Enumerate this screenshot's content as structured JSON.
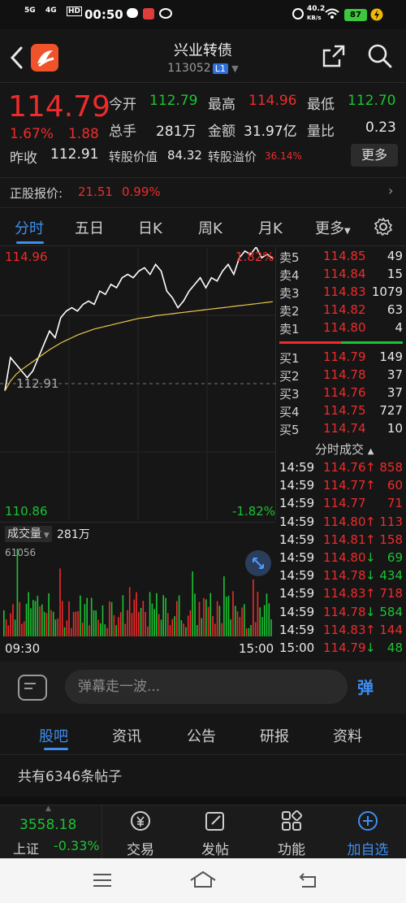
{
  "status_bar": {
    "time": "00:50",
    "signal1": "5G",
    "signal2": "4G",
    "hd": "HD",
    "speed": "40.2",
    "speed_unit": "KB/s",
    "battery": "87"
  },
  "header": {
    "title": "兴业转债",
    "code": "113052",
    "badge": "L1"
  },
  "quote": {
    "price": "114.79",
    "change_pct": "1.67%",
    "change": "1.88",
    "prev_close_label": "昨收",
    "prev_close": "112.91",
    "open_label": "今开",
    "open": "112.79",
    "high_label": "最高",
    "high": "114.96",
    "low_label": "最低",
    "low": "112.70",
    "turnover_label": "总手",
    "turnover": "281万",
    "amount_label": "金额",
    "amount": "31.97亿",
    "ratio_label": "量比",
    "ratio": "0.23",
    "conv_value_label": "转股价值",
    "conv_value": "84.32",
    "conv_premium_label": "转股溢价",
    "conv_premium": "36.14%",
    "more_label": "更多"
  },
  "underlying": {
    "label": "正股报价:",
    "price": "21.51",
    "pct": "0.99%"
  },
  "tabs": {
    "items": [
      "分时",
      "五日",
      "日K",
      "周K",
      "月K",
      "更多"
    ]
  },
  "chart": {
    "top_price": "114.96",
    "top_pct": "1.82%",
    "mid_price": "112.91",
    "bottom_price": "110.86",
    "bottom_pct": "-1.82%",
    "start_time": "09:30",
    "end_time": "15:00",
    "vol_label": "成交量",
    "vol_total": "281万",
    "vol_max": "61056"
  },
  "chart_data": {
    "type": "line",
    "ylim": [
      110.86,
      114.96
    ],
    "reference": 112.91,
    "series": [
      {
        "values": [
          112.8,
          113.3,
          113.2,
          113.1,
          113.0,
          113.1,
          113.3,
          113.5,
          113.7,
          113.6,
          113.9,
          114.0,
          114.05,
          114.0,
          114.1,
          114.15,
          114.1,
          114.3,
          114.25,
          114.4,
          114.35,
          114.5,
          114.55,
          114.5,
          114.6,
          114.65,
          114.55,
          114.7,
          114.6,
          114.3,
          114.2,
          114.05,
          114.15,
          114.3,
          114.4,
          114.5,
          114.35,
          114.5,
          114.45,
          114.6,
          114.7,
          114.55,
          114.8,
          114.9,
          114.85,
          114.96,
          114.8,
          114.85,
          114.79
        ]
      },
      {
        "values": [
          112.8,
          112.95,
          113.05,
          113.12,
          113.18,
          113.24,
          113.3,
          113.36,
          113.42,
          113.47,
          113.52,
          113.56,
          113.6,
          113.64,
          113.67,
          113.7,
          113.73,
          113.75,
          113.77,
          113.79,
          113.81,
          113.83,
          113.85,
          113.87,
          113.89,
          113.9,
          113.91,
          113.93,
          113.94,
          113.95,
          113.96,
          113.97,
          113.98,
          113.99,
          114.0,
          114.01,
          114.02,
          114.03,
          114.04,
          114.05,
          114.06,
          114.07,
          114.08,
          114.09,
          114.1,
          114.11,
          114.12,
          114.13,
          114.14
        ]
      }
    ]
  },
  "orderbook": {
    "asks": [
      {
        "label": "卖5",
        "price": "114.85",
        "vol": "49"
      },
      {
        "label": "卖4",
        "price": "114.84",
        "vol": "15"
      },
      {
        "label": "卖3",
        "price": "114.83",
        "vol": "1079"
      },
      {
        "label": "卖2",
        "price": "114.82",
        "vol": "63"
      },
      {
        "label": "卖1",
        "price": "114.80",
        "vol": "4"
      }
    ],
    "bids": [
      {
        "label": "买1",
        "price": "114.79",
        "vol": "149"
      },
      {
        "label": "买2",
        "price": "114.78",
        "vol": "37"
      },
      {
        "label": "买3",
        "price": "114.76",
        "vol": "37"
      },
      {
        "label": "买4",
        "price": "114.75",
        "vol": "727"
      },
      {
        "label": "买5",
        "price": "114.74",
        "vol": "10"
      }
    ]
  },
  "trades": {
    "title": "分时成交",
    "rows": [
      {
        "time": "14:59",
        "price": "114.76",
        "dir": "↑",
        "vol": "858",
        "up": true
      },
      {
        "time": "14:59",
        "price": "114.77",
        "dir": "↑",
        "vol": "60",
        "up": true
      },
      {
        "time": "14:59",
        "price": "114.77",
        "dir": "",
        "vol": "71",
        "up": true
      },
      {
        "time": "14:59",
        "price": "114.80",
        "dir": "↑",
        "vol": "113",
        "up": true
      },
      {
        "time": "14:59",
        "price": "114.81",
        "dir": "↑",
        "vol": "158",
        "up": true
      },
      {
        "time": "14:59",
        "price": "114.80",
        "dir": "↓",
        "vol": "69",
        "up": false
      },
      {
        "time": "14:59",
        "price": "114.78",
        "dir": "↓",
        "vol": "434",
        "up": false
      },
      {
        "time": "14:59",
        "price": "114.83",
        "dir": "↑",
        "vol": "718",
        "up": true
      },
      {
        "time": "14:59",
        "price": "114.78",
        "dir": "↓",
        "vol": "584",
        "up": false
      },
      {
        "time": "14:59",
        "price": "114.83",
        "dir": "↑",
        "vol": "144",
        "up": true
      },
      {
        "time": "15:00",
        "price": "114.79",
        "dir": "↓",
        "vol": "48",
        "up": false
      }
    ]
  },
  "danmu": {
    "placeholder": "弹幕走一波...",
    "btn": "弹"
  },
  "section_tabs": {
    "items": [
      "股吧",
      "资讯",
      "公告",
      "研报",
      "资料"
    ]
  },
  "posts": {
    "count_text": "共有6346条帖子"
  },
  "bottom_nav": {
    "index_value": "3558.18",
    "index_name": "上证",
    "index_pct": "-0.33%",
    "items": [
      "交易",
      "发帖",
      "功能",
      "加自选"
    ]
  }
}
